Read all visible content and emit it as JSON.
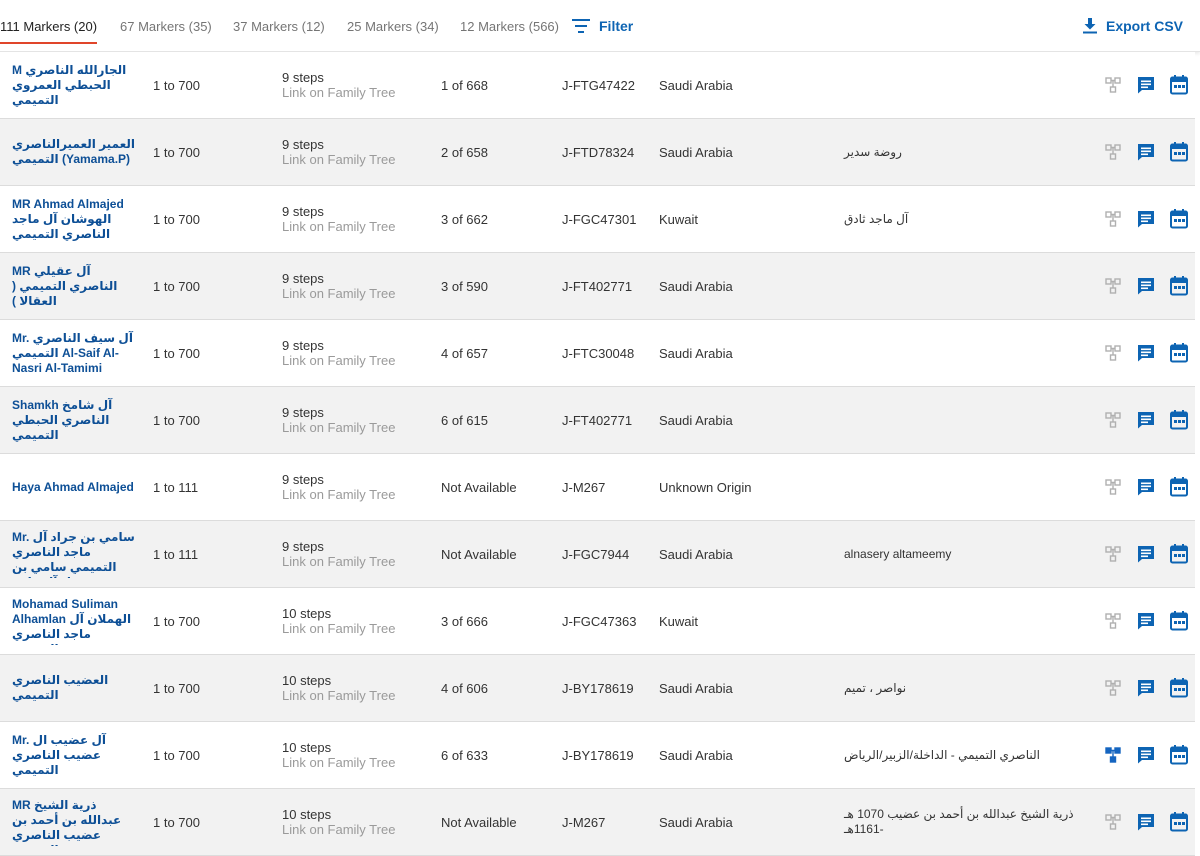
{
  "tabs": [
    {
      "label": "111 Markers (20)",
      "active": true
    },
    {
      "label": "67 Markers (35)",
      "active": false
    },
    {
      "label": "37 Markers (12)",
      "active": false
    },
    {
      "label": "25 Markers (34)",
      "active": false
    },
    {
      "label": "12 Markers (566)",
      "active": false
    }
  ],
  "toolbar": {
    "filter_label": "Filter",
    "filter_icon": "filter-icon",
    "export_label": "Export CSV",
    "export_icon": "download-icon"
  },
  "colors": {
    "accent": "#0d64b3",
    "tab_underline": "#e0452a",
    "tree_icon_muted": "#b0b0b0",
    "tree_icon_active": "#1565c0"
  },
  "rows": [
    {
      "name": "M الجارالله الناصري الحبطي العمروي التميمي",
      "range": "1 to 700",
      "steps": "9 steps",
      "link": "Link on Family Tree",
      "match": "1 of 668",
      "haplogroup": "J-FTG47422",
      "origin": "Saudi Arabia",
      "note": "",
      "tree_active": false
    },
    {
      "name": "العمير العميرالناصري التميمي (Yamama.P)",
      "range": "1 to 700",
      "steps": "9 steps",
      "link": "Link on Family Tree",
      "match": "2 of 658",
      "haplogroup": "J-FTD78324",
      "origin": "Saudi Arabia",
      "note": "روضة سدير",
      "tree_active": false
    },
    {
      "name": "MR Ahmad Almajed الهوشان آل ماجد الناصري التميمي",
      "range": "1 to 700",
      "steps": "9 steps",
      "link": "Link on Family Tree",
      "match": "3 of 662",
      "haplogroup": "J-FGC47301",
      "origin": "Kuwait",
      "note": "آل ماجد ثادق",
      "tree_active": false
    },
    {
      "name": "MR آل عقيلي الناصري التميمي ( العقالا )",
      "range": "1 to 700",
      "steps": "9 steps",
      "link": "Link on Family Tree",
      "match": "3 of 590",
      "haplogroup": "J-FT402771",
      "origin": "Saudi Arabia",
      "note": "",
      "tree_active": false
    },
    {
      "name": "Mr. آل سيف الناصري التميمي Al-Saif Al-Nasri Al-Tamimi",
      "range": "1 to 700",
      "steps": "9 steps",
      "link": "Link on Family Tree",
      "match": "4 of 657",
      "haplogroup": "J-FTC30048",
      "origin": "Saudi Arabia",
      "note": "",
      "tree_active": false
    },
    {
      "name": "Shamkh آل شامخ الناصري الحبطي التميمي",
      "range": "1 to 700",
      "steps": "9 steps",
      "link": "Link on Family Tree",
      "match": "6 of 615",
      "haplogroup": "J-FT402771",
      "origin": "Saudi Arabia",
      "note": "",
      "tree_active": false
    },
    {
      "name": "Haya Ahmad Almajed",
      "range": "1 to 111",
      "steps": "9 steps",
      "link": "Link on Family Tree",
      "match": "Not Available",
      "haplogroup": "J-M267",
      "origin": "Unknown Origin",
      "note": "",
      "tree_active": false
    },
    {
      "name": "Mr. سامي بن جراد آل ماجد الناصري التميمي سامي بن جراد آل ماجد الناصري...",
      "range": "1 to 111",
      "steps": "9 steps",
      "link": "Link on Family Tree",
      "match": "Not Available",
      "haplogroup": "J-FGC7944",
      "origin": "Saudi Arabia",
      "note": "alnasery altameemy",
      "tree_active": false
    },
    {
      "name": "Mohamad Suliman Alhamlan الهملان آل ماجد الناصري التميمي",
      "range": "1 to 700",
      "steps": "10 steps",
      "link": "Link on Family Tree",
      "match": "3 of 666",
      "haplogroup": "J-FGC47363",
      "origin": "Kuwait",
      "note": "",
      "tree_active": false
    },
    {
      "name": "العضيب الناصري التميمي",
      "range": "1 to 700",
      "steps": "10 steps",
      "link": "Link on Family Tree",
      "match": "4 of 606",
      "haplogroup": "J-BY178619",
      "origin": "Saudi Arabia",
      "note": "نواصر ، تميم",
      "tree_active": false
    },
    {
      "name": "Mr. آل عضيب ال عضيب الناصري التميمي",
      "range": "1 to 700",
      "steps": "10 steps",
      "link": "Link on Family Tree",
      "match": "6 of 633",
      "haplogroup": "J-BY178619",
      "origin": "Saudi Arabia",
      "note": "الناصري التميمي - الداخلة/الزبير/الرياض",
      "tree_active": true
    },
    {
      "name": "MR ذرية الشيخ عبدالله بن أحمد بن عضيب الناصري التميمي",
      "range": "1 to 700",
      "steps": "10 steps",
      "link": "Link on Family Tree",
      "match": "Not Available",
      "haplogroup": "J-M267",
      "origin": "Saudi Arabia",
      "note": "ذرية الشيخ عبدالله بن أحمد بن عضيب 1070 هـ -1161هـ",
      "tree_active": false
    }
  ]
}
